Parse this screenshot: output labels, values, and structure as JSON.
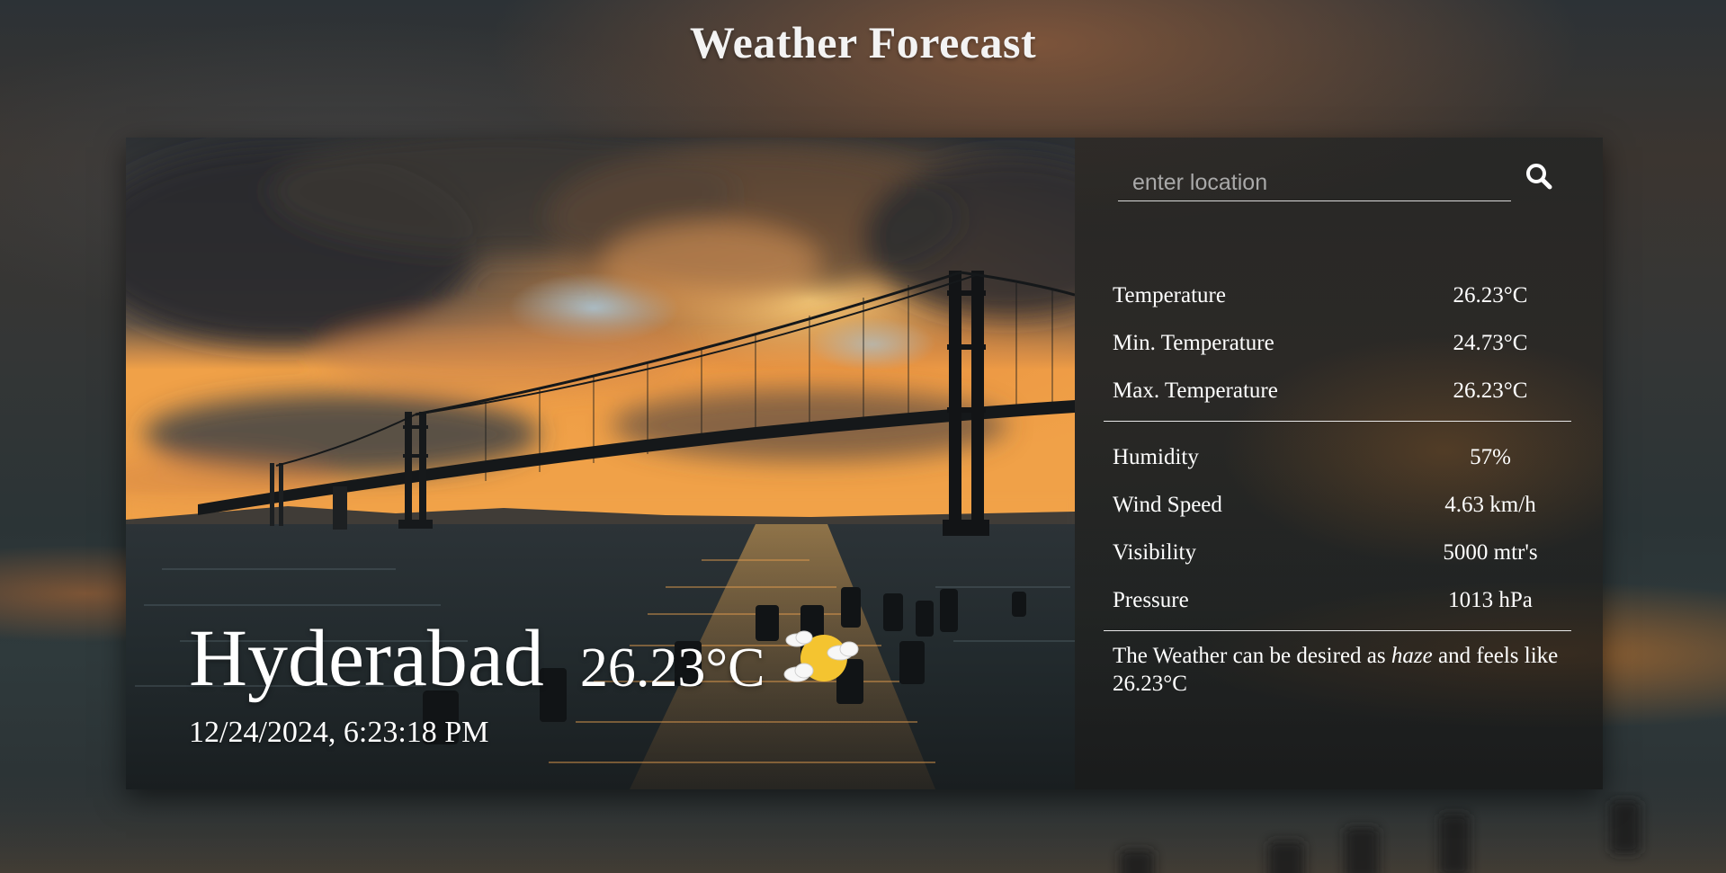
{
  "page": {
    "title": "Weather Forecast"
  },
  "current": {
    "city": "Hyderabad",
    "temperature": "26.23°C",
    "datetime": "12/24/2024, 6:23:18 PM",
    "icon": "partly-cloudy-sun-icon"
  },
  "search": {
    "placeholder": "enter location",
    "value": "",
    "icon": "search-icon"
  },
  "details": {
    "temperature": {
      "label": "Temperature",
      "value": "26.23°C"
    },
    "min_temperature": {
      "label": "Min. Temperature",
      "value": "24.73°C"
    },
    "max_temperature": {
      "label": "Max. Temperature",
      "value": "26.23°C"
    },
    "humidity": {
      "label": "Humidity",
      "value": "57%"
    },
    "wind_speed": {
      "label": "Wind Speed",
      "value": "4.63 km/h"
    },
    "visibility": {
      "label": "Visibility",
      "value": "5000 mtr's"
    },
    "pressure": {
      "label": "Pressure",
      "value": "1013 hPa"
    }
  },
  "description": {
    "prefix": "The Weather can be desired as ",
    "condition": "haze",
    "middle": " and feels like ",
    "feels_like": "26.23°C"
  },
  "colors": {
    "text": "#ffffff",
    "placeholder": "#a9a9a9",
    "sun": "#f4c430",
    "accent_sky": "#e0913a"
  }
}
